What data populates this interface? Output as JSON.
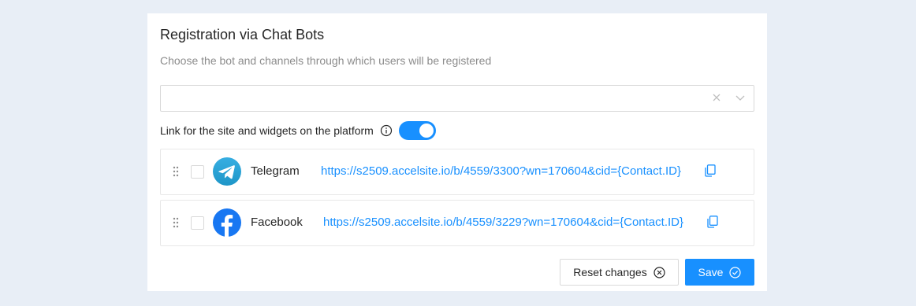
{
  "title": "Registration via Chat Bots",
  "subtitle": "Choose the bot and channels through which users will be registered",
  "bot_select": {
    "value": "",
    "clear_icon": "close-icon",
    "dropdown_icon": "chevron-down-icon"
  },
  "site_link": {
    "label": "Link for the site and widgets on the platform",
    "info_icon": "info-icon",
    "toggle_on": true
  },
  "channels": [
    {
      "name": "Telegram",
      "url": "https://s2509.accelsite.io/b/4559/3300?wn=170604&cid={Contact.ID}",
      "icon": "telegram-icon",
      "checked": false
    },
    {
      "name": "Facebook",
      "url": "https://s2509.accelsite.io/b/4559/3229?wn=170604&cid={Contact.ID}",
      "icon": "facebook-icon",
      "checked": false
    }
  ],
  "buttons": {
    "reset_label": "Reset changes",
    "save_label": "Save"
  },
  "colors": {
    "accent": "#1890ff",
    "background": "#e8eef6",
    "telegram": "#2a9fd8",
    "facebook": "#1877f2"
  }
}
